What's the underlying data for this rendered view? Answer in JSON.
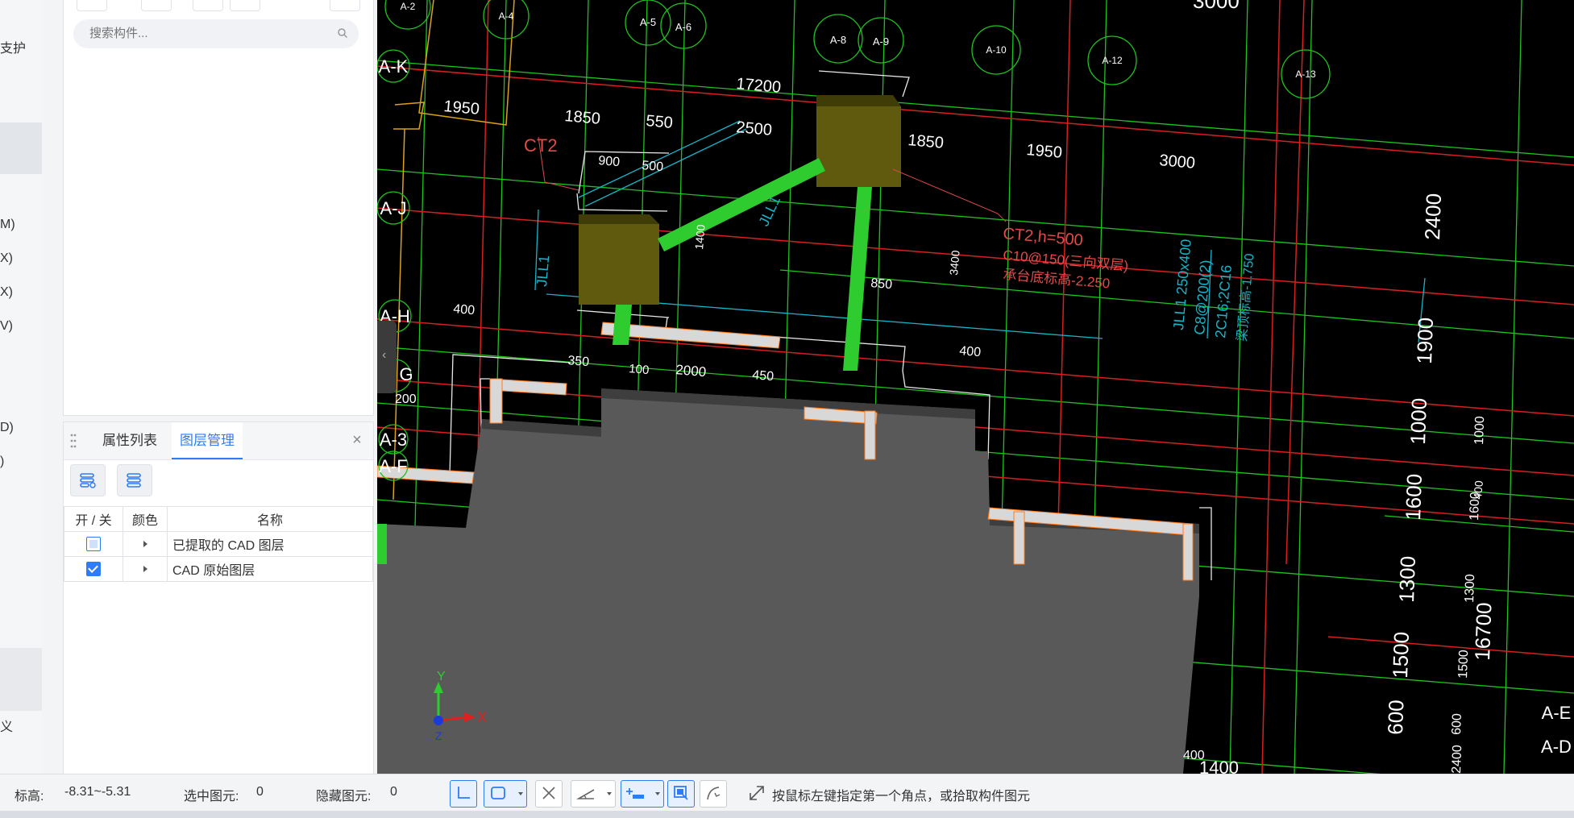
{
  "left_nav": {
    "fragments": [
      "支护",
      "M)",
      "X)",
      "X)",
      "V)",
      "D)",
      ")",
      "义"
    ]
  },
  "component_panel": {
    "search_placeholder": "搜索构件..."
  },
  "layer_panel": {
    "tabs": [
      "属性列表",
      "图层管理"
    ],
    "active_tab": "图层管理",
    "columns": [
      "开 / 关",
      "颜色",
      "名称"
    ],
    "rows": [
      {
        "on": "partial",
        "name": "已提取的 CAD 图层"
      },
      {
        "on": "checked",
        "name": "CAD 原始图层"
      }
    ]
  },
  "cad": {
    "axis_labels": [
      "A-2",
      "A-4",
      "A-5",
      "A-6",
      "A-8",
      "A-9",
      "A-10",
      "A-12",
      "A-13",
      "A-K",
      "A-J",
      "A-H",
      "G",
      "A-3",
      "A-F",
      "A-E",
      "A-D"
    ],
    "dimensions": [
      "3000",
      "17200",
      "1950",
      "1850",
      "550",
      "2500",
      "1850",
      "1950",
      "3000",
      "900",
      "500",
      "1400",
      "3400",
      "850",
      "400",
      "400",
      "100",
      "2000",
      "450",
      "350",
      "200",
      "400",
      "2400",
      "1900",
      "1000",
      "1600",
      "1300",
      "1500",
      "600",
      "16700",
      "1400",
      "1000",
      "1600",
      "1300",
      "1500",
      "600",
      "2400",
      "400"
    ],
    "annotations": {
      "ct2": "CT2",
      "ct2_spec": "CT2,h=500",
      "ct2_rebar": "C10@150(三向双层)",
      "ct2_elev": "承台底标高-2.250",
      "jll1_1": "JLL1",
      "jll1_2": "JLL1",
      "beam_spec": "JLL1 250x400",
      "beam_stirrup": "C8@200(2)",
      "beam_bars": "2C16;2C16",
      "beam_elev": "梁顶标高-1.750"
    },
    "axis_x": "X",
    "axis_y": "Y",
    "axis_z": "Z"
  },
  "status_bar": {
    "elevation_label": "标高:",
    "elevation_value": "-8.31~-5.31",
    "selected_label": "选中图元:",
    "selected_value": "0",
    "hidden_label": "隐藏图元:",
    "hidden_value": "0",
    "prompt": "按鼠标左键指定第一个角点，或拾取构件图元"
  },
  "colors": {
    "accent": "#2e7cf6",
    "grid_green": "#1ec31e",
    "grid_red": "#d81f1f",
    "cad_bg": "#000000",
    "cap_olive": "#5f5a0e",
    "beam_green": "#2fcc2f"
  }
}
